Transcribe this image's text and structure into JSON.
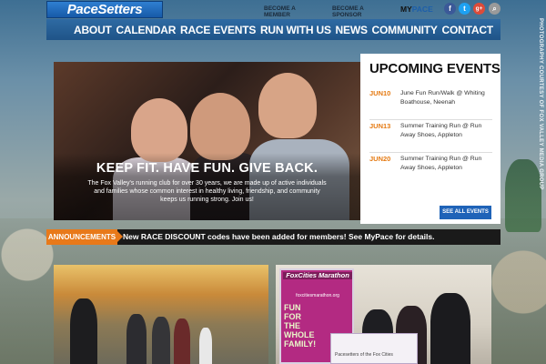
{
  "header": {
    "logo_text": "PaceSetters",
    "become_member": "BECOME A MEMBER",
    "become_sponsor": "BECOME A SPONSOR",
    "mypace_prefix": "MY",
    "mypace_suffix": "PACE"
  },
  "social": {
    "facebook": "f",
    "twitter": "t",
    "googleplus": "g+",
    "search": "⌕"
  },
  "nav": {
    "items": [
      "ABOUT",
      "CALENDAR",
      "RACE EVENTS",
      "RUN WITH US",
      "NEWS",
      "COMMUNITY",
      "CONTACT"
    ]
  },
  "hero": {
    "title": "KEEP FIT. HAVE FUN. GIVE BACK.",
    "description": "The Fox Valley's running club for over 30 years, we are made up of active individuals and families whose common interest in healthy living, friendship, and community keeps us running strong. Join us!"
  },
  "events": {
    "title": "UPCOMING EVENTS",
    "items": [
      {
        "date": "JUN10",
        "name": "June Fun Run/Walk @ Whiting Boathouse, Neenah"
      },
      {
        "date": "JUN13",
        "name": "Summer Training Run @ Run Away Shoes, Appleton"
      },
      {
        "date": "JUN20",
        "name": "Summer Training Run @ Run Away Shoes, Appleton"
      }
    ],
    "see_all": "SEE ALL EVENTS"
  },
  "announcements": {
    "label": "ANNOUNCEMENTS",
    "text": "New RACE DISCOUNT codes have been added for members! See MyPace for details."
  },
  "photo2": {
    "poster_title": "FoxCities Marathon",
    "poster_url": "foxcitiesmarathon.org",
    "poster_big": "FUN FOR THE WHOLE FAMILY!",
    "check_text": "Pacesetters of the Fox Cities"
  },
  "credit": "PHOTOGRAPHY COURTESY OF FOX VALLEY MEDIA GROUP",
  "colors": {
    "brand_blue": "#1f5488",
    "accent_orange": "#e8791a",
    "event_date": "#e57a12",
    "button_blue": "#1f63b8"
  }
}
